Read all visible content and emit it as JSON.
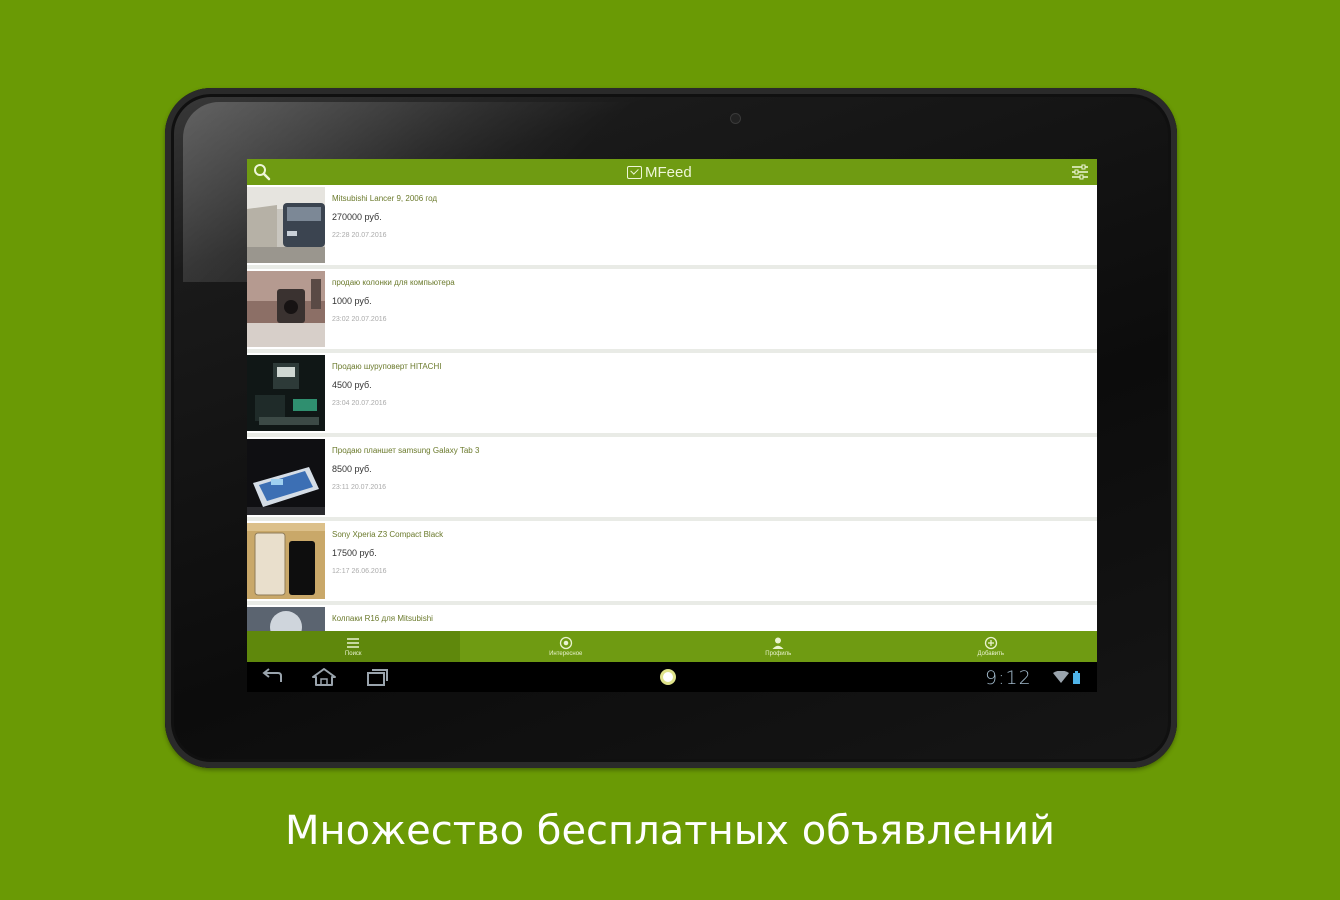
{
  "app": {
    "title": "MFeed"
  },
  "listings": [
    {
      "title": "Mitsubishi Lancer 9, 2006 год",
      "price": "270000 руб.",
      "date": "22:28 20.07.2016"
    },
    {
      "title": "продаю колонки для компьютера",
      "price": "1000 руб.",
      "date": "23:02 20.07.2016"
    },
    {
      "title": "Продаю шуруповерт HITACHI",
      "price": "4500 руб.",
      "date": "23:04 20.07.2016"
    },
    {
      "title": "Продаю планшет samsung Galaxy Tab 3",
      "price": "8500 руб.",
      "date": "23:11 20.07.2016"
    },
    {
      "title": "Sony Xperia Z3 Compact Black",
      "price": "17500 руб.",
      "date": "12:17 26.06.2016"
    },
    {
      "title": "Колпаки R16 для Mitsubishi",
      "price": "",
      "date": ""
    }
  ],
  "tabs": [
    {
      "label": "Поиск",
      "icon": "list-icon"
    },
    {
      "label": "Интересное",
      "icon": "star-circle-icon"
    },
    {
      "label": "Профиль",
      "icon": "person-icon"
    },
    {
      "label": "Добавить",
      "icon": "plus-circle-icon"
    }
  ],
  "system": {
    "time": "9:12"
  },
  "caption": "Множество бесплатных объявлений",
  "colors": {
    "background": "#6a9a05",
    "bar": "#6f9b12",
    "tab_active": "#5f880c"
  }
}
